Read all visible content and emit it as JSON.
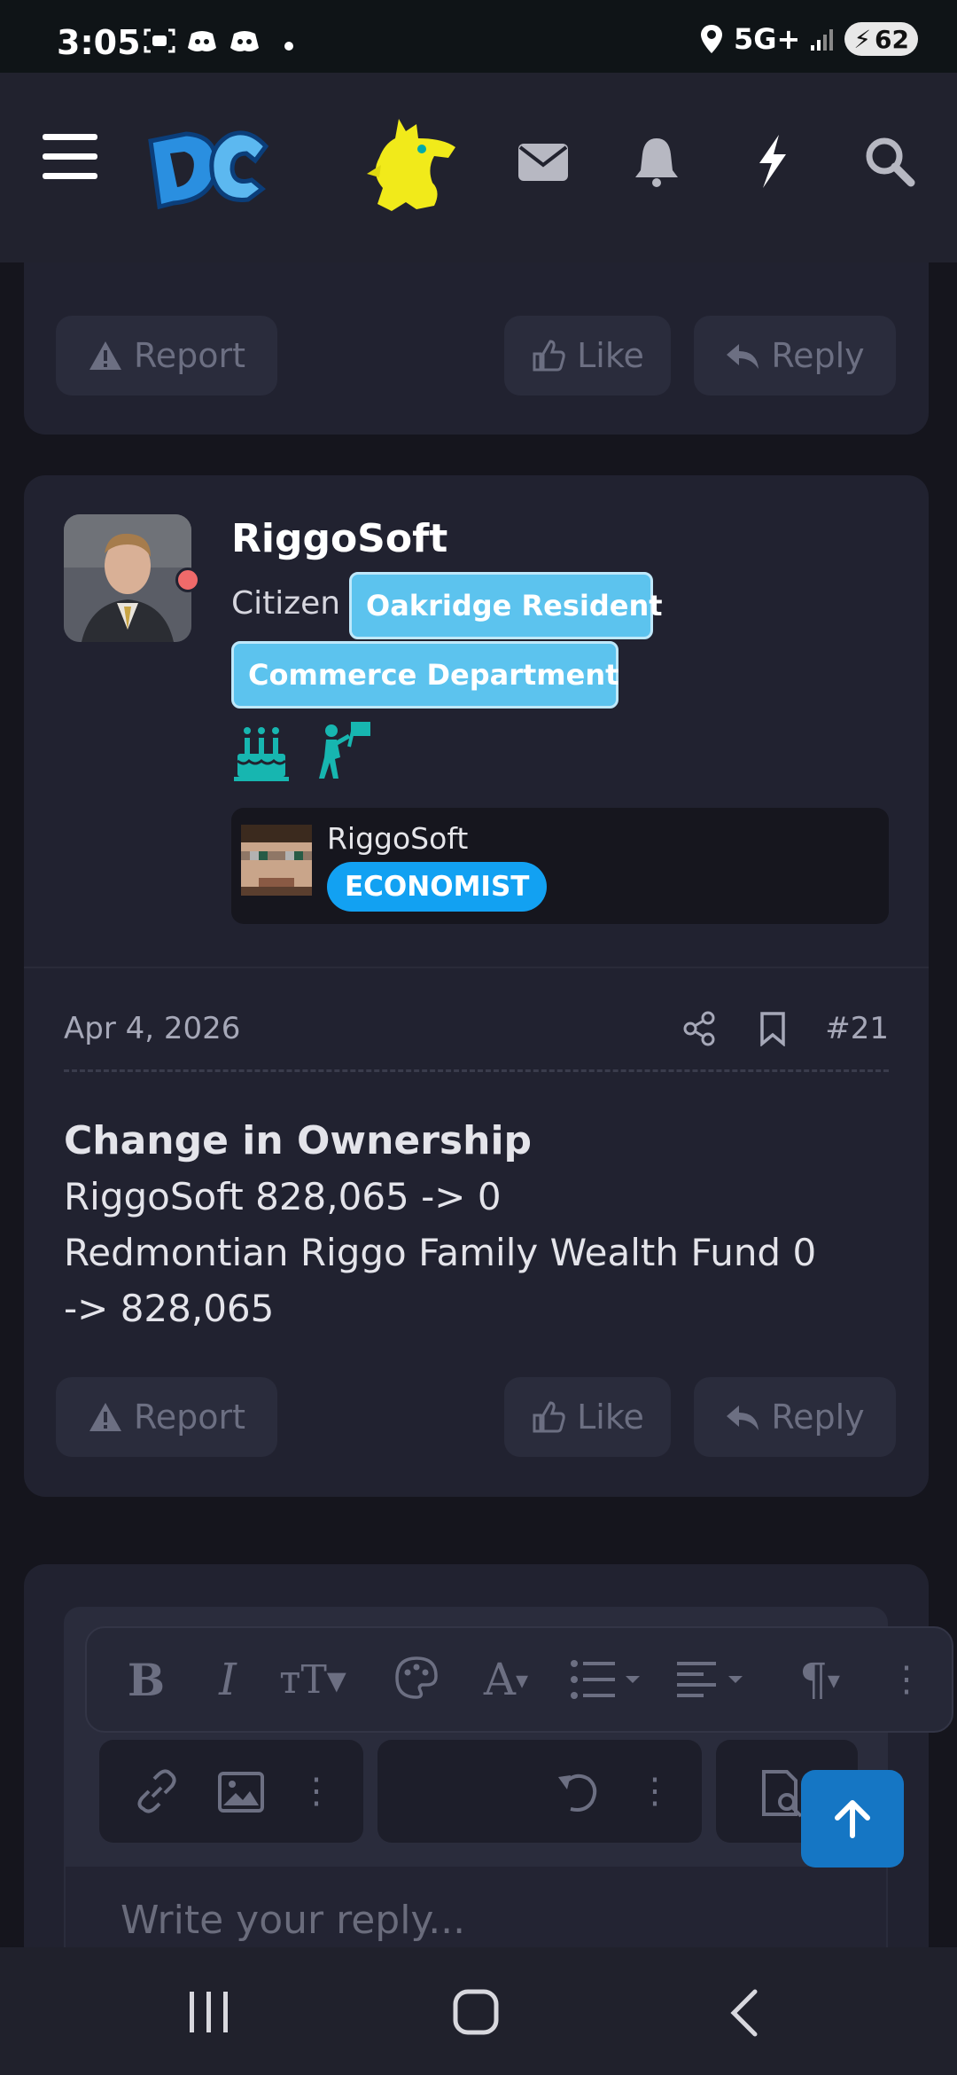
{
  "status_bar": {
    "time": "3:05",
    "network": "5G+",
    "battery": "62"
  },
  "header": {
    "logo_text": "DC",
    "icons": [
      "menu-icon",
      "dc-logo",
      "dragon-mascot-icon",
      "mail-icon",
      "bell-icon",
      "lightning-icon",
      "search-icon"
    ]
  },
  "prev_post": {
    "report_label": "Report",
    "like_label": "Like",
    "reply_label": "Reply"
  },
  "post": {
    "username": "RiggoSoft",
    "user_title": "Citizen",
    "banners": [
      "Oakridge Resident",
      "Commerce Department"
    ],
    "character": {
      "name": "RiggoSoft",
      "badge": "ECONOMIST"
    },
    "date": "Apr 4, 2026",
    "number": "#21",
    "heading": "Change in Ownership",
    "lines": [
      "RiggoSoft 828,065 -> 0",
      "Redmontian Riggo Family Wealth Fund 0",
      "-> 828,065"
    ],
    "report_label": "Report",
    "like_label": "Like",
    "reply_label": "Reply"
  },
  "editor": {
    "placeholder": "Write your reply..."
  },
  "colors": {
    "background": "#15151d",
    "card": "#212230",
    "banner": "#5cc3ee",
    "badge": "#12a1f2",
    "to_top": "#1576c4"
  }
}
